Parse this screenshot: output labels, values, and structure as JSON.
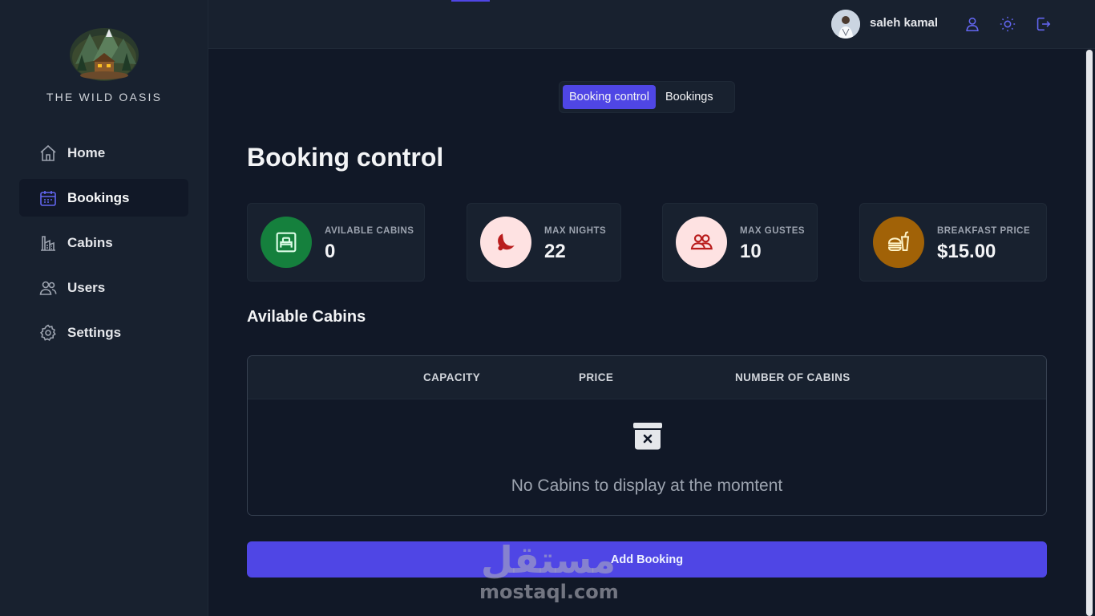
{
  "app": {
    "brand_name": "THE WILD OASIS"
  },
  "sidebar": {
    "items": [
      {
        "label": "Home",
        "icon": "home-icon",
        "active": false
      },
      {
        "label": "Bookings",
        "icon": "calendar-icon",
        "active": true
      },
      {
        "label": "Cabins",
        "icon": "cabins-icon",
        "active": false
      },
      {
        "label": "Users",
        "icon": "users-icon",
        "active": false
      },
      {
        "label": "Settings",
        "icon": "gear-icon",
        "active": false
      }
    ]
  },
  "header": {
    "username": "saleh kamal",
    "buttons": [
      {
        "icon": "user-icon"
      },
      {
        "icon": "sun-icon"
      },
      {
        "icon": "logout-icon"
      }
    ]
  },
  "main": {
    "tabs": [
      {
        "label": "Booking control",
        "active": true
      },
      {
        "label": "Bookings",
        "active": false
      }
    ],
    "title": "Booking control",
    "stats": [
      {
        "label": "AVILABLE CABINS",
        "value": "0",
        "icon": "cabin-icon",
        "icon_bg": "#15803d"
      },
      {
        "label": "MAX NIGHTS",
        "value": "22",
        "icon": "moon-icon",
        "icon_bg": "#fee2e2"
      },
      {
        "label": "MAX GUSTES",
        "value": "10",
        "icon": "guests-icon",
        "icon_bg": "#fee2e2"
      },
      {
        "label": "BREAKFAST PRICE",
        "value": "$15.00",
        "icon": "food-icon",
        "icon_bg": "#a16207"
      }
    ],
    "section_title": "Avilable Cabins",
    "table": {
      "columns": [
        "CAPACITY",
        "PRICE",
        "NUMBER OF CABINS"
      ],
      "rows": [],
      "empty_message": "No Cabins to display at the momtent"
    },
    "add_button_label": "Add Booking"
  },
  "watermark": {
    "arabic": "مستقل",
    "latin": "mostaql.com"
  },
  "colors": {
    "accent": "#4f46e5",
    "background": "#111827",
    "panel": "#18212f"
  }
}
